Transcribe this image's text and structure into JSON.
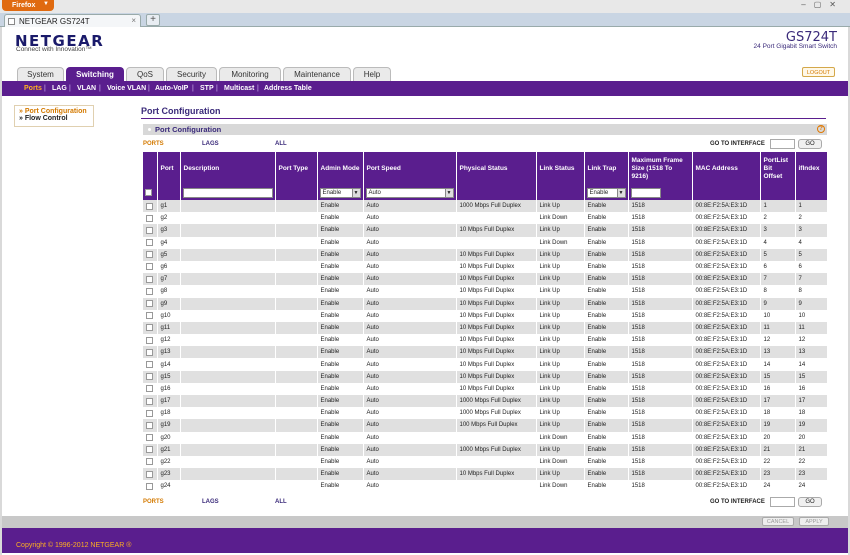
{
  "browser": {
    "app_button": "Firefox",
    "tab_title": "NETGEAR GS724T",
    "new_tab": "+"
  },
  "brand": {
    "logo": "NETGEAR",
    "tagline": "Connect with Innovation™",
    "model": "GS724T",
    "model_sub": "24 Port Gigabit Smart Switch"
  },
  "main_nav": [
    "System",
    "Switching",
    "QoS",
    "Security",
    "Monitoring",
    "Maintenance",
    "Help"
  ],
  "logout": "LOGOUT",
  "sub_nav": [
    "Ports",
    "LAG",
    "VLAN",
    "Voice VLAN",
    "Auto-VoIP",
    "STP",
    "Multicast",
    "Address Table"
  ],
  "left_nav": [
    "» Port Configuration",
    "» Flow Control"
  ],
  "page_title": "Port Configuration",
  "panel_title": "Port Configuration",
  "help_icon": "?",
  "filters": {
    "ports": "PORTS",
    "lags": "LAGS",
    "all": "ALL"
  },
  "goto": {
    "label": "GO TO INTERFACE",
    "button": "GO"
  },
  "columns": [
    "",
    "Port",
    "Description",
    "Port Type",
    "Admin Mode",
    "Port Speed",
    "Physical Status",
    "Link Status",
    "Link Trap",
    "Maximum Frame Size (1518 To 9216)",
    "MAC Address",
    "PortList Bit Offset",
    "ifIndex"
  ],
  "edit_row": {
    "admin_mode": "Enable",
    "port_speed": "Auto",
    "link_trap": "Enable"
  },
  "rows": [
    {
      "port": "g1",
      "admin": "Enable",
      "speed": "Auto",
      "phys": "1000 Mbps Full Duplex",
      "link": "Link Up",
      "trap": "Enable",
      "frame": "1518",
      "mac": "00:8E:F2:5A:E3:1D",
      "offset": "1",
      "ifindex": "1"
    },
    {
      "port": "g2",
      "admin": "Enable",
      "speed": "Auto",
      "phys": "",
      "link": "Link Down",
      "trap": "Enable",
      "frame": "1518",
      "mac": "00:8E:F2:5A:E3:1D",
      "offset": "2",
      "ifindex": "2"
    },
    {
      "port": "g3",
      "admin": "Enable",
      "speed": "Auto",
      "phys": "10 Mbps Full Duplex",
      "link": "Link Up",
      "trap": "Enable",
      "frame": "1518",
      "mac": "00:8E:F2:5A:E3:1D",
      "offset": "3",
      "ifindex": "3"
    },
    {
      "port": "g4",
      "admin": "Enable",
      "speed": "Auto",
      "phys": "",
      "link": "Link Down",
      "trap": "Enable",
      "frame": "1518",
      "mac": "00:8E:F2:5A:E3:1D",
      "offset": "4",
      "ifindex": "4"
    },
    {
      "port": "g5",
      "admin": "Enable",
      "speed": "Auto",
      "phys": "10 Mbps Full Duplex",
      "link": "Link Up",
      "trap": "Enable",
      "frame": "1518",
      "mac": "00:8E:F2:5A:E3:1D",
      "offset": "5",
      "ifindex": "5"
    },
    {
      "port": "g6",
      "admin": "Enable",
      "speed": "Auto",
      "phys": "10 Mbps Full Duplex",
      "link": "Link Up",
      "trap": "Enable",
      "frame": "1518",
      "mac": "00:8E:F2:5A:E3:1D",
      "offset": "6",
      "ifindex": "6"
    },
    {
      "port": "g7",
      "admin": "Enable",
      "speed": "Auto",
      "phys": "10 Mbps Full Duplex",
      "link": "Link Up",
      "trap": "Enable",
      "frame": "1518",
      "mac": "00:8E:F2:5A:E3:1D",
      "offset": "7",
      "ifindex": "7"
    },
    {
      "port": "g8",
      "admin": "Enable",
      "speed": "Auto",
      "phys": "10 Mbps Full Duplex",
      "link": "Link Up",
      "trap": "Enable",
      "frame": "1518",
      "mac": "00:8E:F2:5A:E3:1D",
      "offset": "8",
      "ifindex": "8"
    },
    {
      "port": "g9",
      "admin": "Enable",
      "speed": "Auto",
      "phys": "10 Mbps Full Duplex",
      "link": "Link Up",
      "trap": "Enable",
      "frame": "1518",
      "mac": "00:8E:F2:5A:E3:1D",
      "offset": "9",
      "ifindex": "9"
    },
    {
      "port": "g10",
      "admin": "Enable",
      "speed": "Auto",
      "phys": "10 Mbps Full Duplex",
      "link": "Link Up",
      "trap": "Enable",
      "frame": "1518",
      "mac": "00:8E:F2:5A:E3:1D",
      "offset": "10",
      "ifindex": "10"
    },
    {
      "port": "g11",
      "admin": "Enable",
      "speed": "Auto",
      "phys": "10 Mbps Full Duplex",
      "link": "Link Up",
      "trap": "Enable",
      "frame": "1518",
      "mac": "00:8E:F2:5A:E3:1D",
      "offset": "11",
      "ifindex": "11"
    },
    {
      "port": "g12",
      "admin": "Enable",
      "speed": "Auto",
      "phys": "10 Mbps Full Duplex",
      "link": "Link Up",
      "trap": "Enable",
      "frame": "1518",
      "mac": "00:8E:F2:5A:E3:1D",
      "offset": "12",
      "ifindex": "12"
    },
    {
      "port": "g13",
      "admin": "Enable",
      "speed": "Auto",
      "phys": "10 Mbps Full Duplex",
      "link": "Link Up",
      "trap": "Enable",
      "frame": "1518",
      "mac": "00:8E:F2:5A:E3:1D",
      "offset": "13",
      "ifindex": "13"
    },
    {
      "port": "g14",
      "admin": "Enable",
      "speed": "Auto",
      "phys": "10 Mbps Full Duplex",
      "link": "Link Up",
      "trap": "Enable",
      "frame": "1518",
      "mac": "00:8E:F2:5A:E3:1D",
      "offset": "14",
      "ifindex": "14"
    },
    {
      "port": "g15",
      "admin": "Enable",
      "speed": "Auto",
      "phys": "10 Mbps Full Duplex",
      "link": "Link Up",
      "trap": "Enable",
      "frame": "1518",
      "mac": "00:8E:F2:5A:E3:1D",
      "offset": "15",
      "ifindex": "15"
    },
    {
      "port": "g16",
      "admin": "Enable",
      "speed": "Auto",
      "phys": "10 Mbps Full Duplex",
      "link": "Link Up",
      "trap": "Enable",
      "frame": "1518",
      "mac": "00:8E:F2:5A:E3:1D",
      "offset": "16",
      "ifindex": "16"
    },
    {
      "port": "g17",
      "admin": "Enable",
      "speed": "Auto",
      "phys": "1000 Mbps Full Duplex",
      "link": "Link Up",
      "trap": "Enable",
      "frame": "1518",
      "mac": "00:8E:F2:5A:E3:1D",
      "offset": "17",
      "ifindex": "17"
    },
    {
      "port": "g18",
      "admin": "Enable",
      "speed": "Auto",
      "phys": "1000 Mbps Full Duplex",
      "link": "Link Up",
      "trap": "Enable",
      "frame": "1518",
      "mac": "00:8E:F2:5A:E3:1D",
      "offset": "18",
      "ifindex": "18"
    },
    {
      "port": "g19",
      "admin": "Enable",
      "speed": "Auto",
      "phys": "100 Mbps Full Duplex",
      "link": "Link Up",
      "trap": "Enable",
      "frame": "1518",
      "mac": "00:8E:F2:5A:E3:1D",
      "offset": "19",
      "ifindex": "19"
    },
    {
      "port": "g20",
      "admin": "Enable",
      "speed": "Auto",
      "phys": "",
      "link": "Link Down",
      "trap": "Enable",
      "frame": "1518",
      "mac": "00:8E:F2:5A:E3:1D",
      "offset": "20",
      "ifindex": "20"
    },
    {
      "port": "g21",
      "admin": "Enable",
      "speed": "Auto",
      "phys": "1000 Mbps Full Duplex",
      "link": "Link Up",
      "trap": "Enable",
      "frame": "1518",
      "mac": "00:8E:F2:5A:E3:1D",
      "offset": "21",
      "ifindex": "21"
    },
    {
      "port": "g22",
      "admin": "Enable",
      "speed": "Auto",
      "phys": "",
      "link": "Link Down",
      "trap": "Enable",
      "frame": "1518",
      "mac": "00:8E:F2:5A:E3:1D",
      "offset": "22",
      "ifindex": "22"
    },
    {
      "port": "g23",
      "admin": "Enable",
      "speed": "Auto",
      "phys": "10 Mbps Full Duplex",
      "link": "Link Up",
      "trap": "Enable",
      "frame": "1518",
      "mac": "00:8E:F2:5A:E3:1D",
      "offset": "23",
      "ifindex": "23"
    },
    {
      "port": "g24",
      "admin": "Enable",
      "speed": "Auto",
      "phys": "",
      "link": "Link Down",
      "trap": "Enable",
      "frame": "1518",
      "mac": "00:8E:F2:5A:E3:1D",
      "offset": "24",
      "ifindex": "24"
    }
  ],
  "buttons": {
    "cancel": "CANCEL",
    "apply": "APPLY"
  },
  "footer": "Copyright © 1996-2012 NETGEAR ®",
  "colors": {
    "brand_purple": "#5a1e8e",
    "accent_orange": "#d47a00"
  }
}
